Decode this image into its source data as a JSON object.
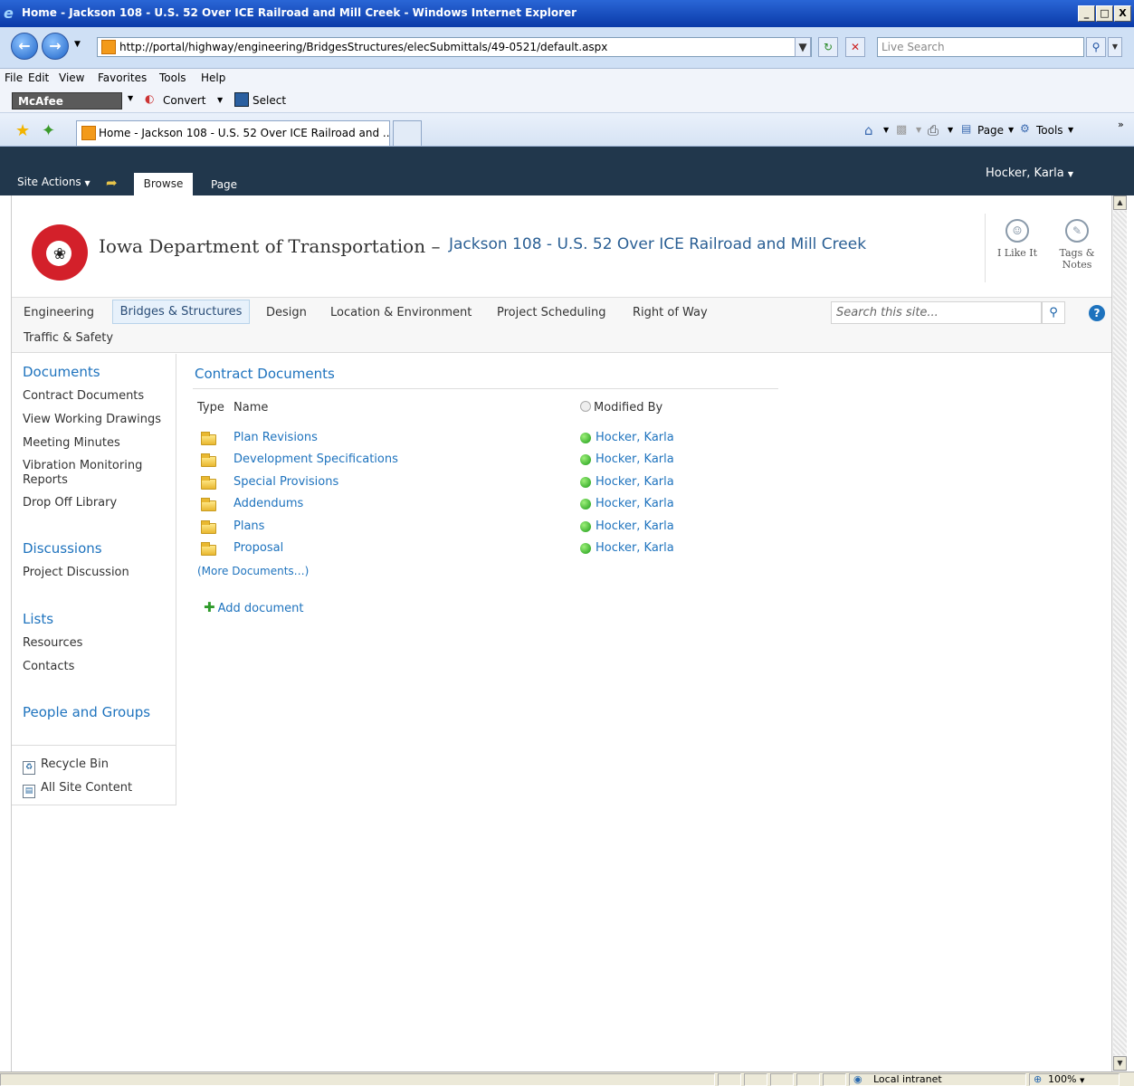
{
  "window": {
    "title": "Home - Jackson 108 - U.S. 52 Over ICE Railroad and Mill Creek - Windows Internet Explorer",
    "controls": [
      "_",
      "□",
      "X"
    ]
  },
  "addressbar": {
    "url": "http://portal/highway/engineering/BridgesStructures/elecSubmittals/49-0521/default.aspx",
    "search_placeholder": "Live Search"
  },
  "menubar": [
    "File",
    "Edit",
    "View",
    "Favorites",
    "Tools",
    "Help"
  ],
  "mcafee_toolbar": {
    "mcafee_label": "McAfee",
    "convert_label": "Convert",
    "select_label": "Select"
  },
  "tabs": {
    "active_tab": "Home - Jackson 108 - U.S. 52 Over ICE Railroad and ...",
    "command_page": "Page",
    "command_tools": "Tools"
  },
  "ribbon": {
    "site_actions": "Site Actions",
    "browse": "Browse",
    "page": "Page",
    "user": "Hocker, Karla"
  },
  "header": {
    "org_name": "Iowa Department of Transportation –",
    "site_title": "Jackson 108 - U.S. 52 Over ICE Railroad and Mill Creek",
    "i_like_it": "I Like It",
    "tags_notes_line1": "Tags &",
    "tags_notes_line2": "Notes"
  },
  "topnav": {
    "items": [
      "Engineering",
      "Bridges & Structures",
      "Design",
      "Location & Environment",
      "Project Scheduling",
      "Right of Way",
      "Traffic & Safety"
    ],
    "search_placeholder": "Search this site..."
  },
  "quicklaunch": {
    "documents_heading": "Documents",
    "documents": [
      "Contract Documents",
      "View Working Drawings",
      "Meeting Minutes",
      "Vibration Monitoring",
      "Reports",
      "Drop Off Library"
    ],
    "discussions_heading": "Discussions",
    "discussions": [
      "Project Discussion"
    ],
    "lists_heading": "Lists",
    "lists": [
      "Resources",
      "Contacts"
    ],
    "people_heading": "People and Groups",
    "recycle_bin": "Recycle Bin",
    "all_site_content": "All Site Content"
  },
  "webpart": {
    "title": "Contract Documents",
    "col_type": "Type",
    "col_name": "Name",
    "col_modified_by": "Modified By",
    "rows": [
      {
        "name": "Plan Revisions",
        "modified_by": "Hocker, Karla"
      },
      {
        "name": "Development Specifications",
        "modified_by": "Hocker, Karla"
      },
      {
        "name": "Special Provisions",
        "modified_by": "Hocker, Karla"
      },
      {
        "name": "Addendums",
        "modified_by": "Hocker, Karla"
      },
      {
        "name": "Plans",
        "modified_by": "Hocker, Karla"
      },
      {
        "name": "Proposal",
        "modified_by": "Hocker, Karla"
      }
    ],
    "more_documents": "(More Documents…)",
    "add_document": "Add document"
  },
  "statusbar": {
    "zone": "Local intranet",
    "zoom": "100%"
  }
}
